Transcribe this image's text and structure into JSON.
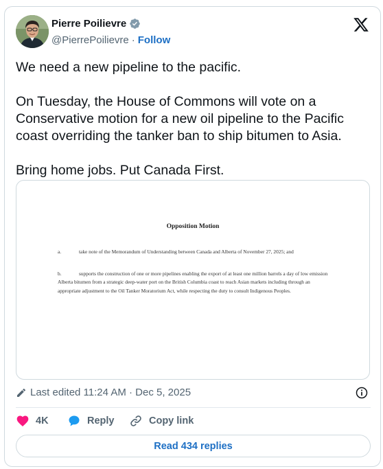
{
  "author": {
    "name": "Pierre Poilievre",
    "handle": "@PierrePoilievre",
    "separator": "·",
    "follow_label": "Follow"
  },
  "tweet": {
    "paragraphs": [
      "We need a new pipeline to the pacific.",
      "On Tuesday, the House of Commons will vote on a Conservative motion for a new oil pipeline to the Pacific coast overriding the tanker ban to ship bitumen to Asia.",
      "Bring home jobs. Put Canada First."
    ]
  },
  "document": {
    "title": "Opposition Motion",
    "items": [
      {
        "letter": "a.",
        "text": "take note of the Memorandum of Understanding between Canada and Alberta of November 27, 2025; and"
      },
      {
        "letter": "b.",
        "text": "supports the construction of one or more pipelines enabling the export of at least one million barrels a day of low emission Alberta bitumen from a strategic deep-water port on the British Columbia coast to reach Asian markets including through an appropriate adjustment to the Oil Tanker Moratorium Act, while respecting the duty to consult Indigenous Peoples."
      }
    ]
  },
  "meta": {
    "edited_text": "Last edited 11:24 AM · Dec 5, 2025"
  },
  "actions": {
    "like_count": "4K",
    "reply_label": "Reply",
    "copy_link_label": "Copy link"
  },
  "read_replies_label": "Read 434 replies",
  "colors": {
    "accent": "#1d6fc4",
    "like": "#f91880",
    "verified": "#829aab",
    "muted_text": "#536471",
    "border": "#cfd9de"
  },
  "icons": {
    "brand": "x-logo-icon",
    "verified": "verified-badge-icon",
    "edit": "pencil-icon",
    "info": "info-icon",
    "like": "heart-icon",
    "reply": "speech-bubble-icon",
    "copy": "link-icon"
  }
}
